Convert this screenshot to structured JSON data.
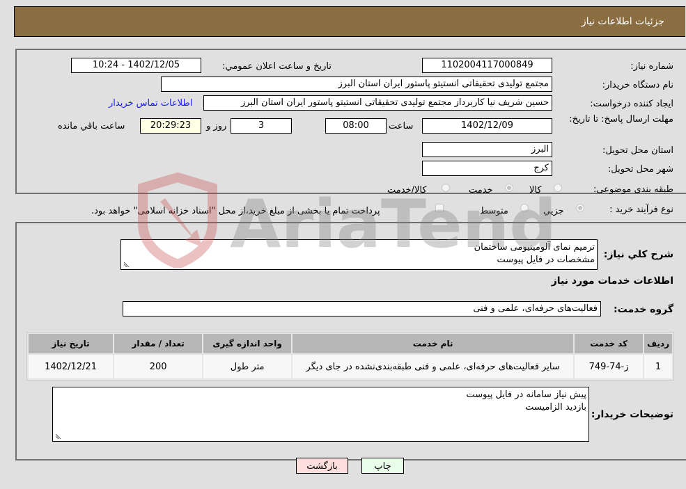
{
  "header": {
    "title": "جزئیات اطلاعات نیاز"
  },
  "fields": {
    "need_number_label": "شماره نیاز:",
    "need_number": "1102004117000849",
    "announce_label": "تاریخ و ساعت اعلان عمومي:",
    "announce_value": "1402/12/05 - 10:24",
    "buyer_org_label": "نام دستگاه خريدار:",
    "buyer_org": "مجتمع تولیدی تحقیقاتی انستیتو پاستور ایران استان البرز",
    "creator_label": "ايجاد کننده درخواست:",
    "creator": "حسین شریف نیا کاربرداز مجتمع تولیدی تحقیقاتی انستیتو پاستور ایران استان البرز",
    "contact_link": "اطلاعات تماس خريدار",
    "deadline_label": "مهلت ارسال پاسخ: تا تاریخ:",
    "deadline_date": "1402/12/09",
    "hour_label": "ساعت",
    "deadline_time": "08:00",
    "days": "3",
    "days_label": "روز و",
    "remaining_time": "20:29:23",
    "remaining_label": "ساعت باقي مانده",
    "province_label": "استان محل تحويل:",
    "province": "البرز",
    "city_label": "شهر محل تحويل:",
    "city": "کرج",
    "category_label": "طبقه بندی موضوعی:",
    "category_options": [
      {
        "label": "کالا",
        "checked": false
      },
      {
        "label": "خدمت",
        "checked": true
      },
      {
        "label": "کالا/خدمت",
        "checked": false
      }
    ],
    "process_label": "نوع فرآيند خريد :",
    "process_options": [
      {
        "label": "جزيي",
        "checked": true
      },
      {
        "label": "متوسط",
        "checked": false
      }
    ],
    "treasury_checkbox_label": "پرداخت تمام یا بخشی از مبلغ خرید،از محل \"اسناد خزانه اسلامی\" خواهد بود."
  },
  "description": {
    "label": "شرح كلي نياز:",
    "lines": [
      "ترمیم نمای آلومینیومی ساختمان",
      "مشخصات در فایل پیوست"
    ]
  },
  "services_section_title": "اطلاعات خدمات مورد نياز",
  "service_group": {
    "label": "گروه خدمت:",
    "value": "فعالیت‌های حرفه‌ای، علمی و فنی"
  },
  "table": {
    "headers": [
      "ردیف",
      "کد خدمت",
      "نام خدمت",
      "واحد اندازه گیری",
      "تعداد / مقدار",
      "تاریخ نیاز"
    ],
    "rows": [
      [
        "1",
        "ز-74-749",
        "سایر فعالیت‌های حرفه‌ای، علمی و فنی طبقه‌بندی‌نشده در جای دیگر",
        "متر طول",
        "200",
        "1402/12/21"
      ]
    ]
  },
  "buyer_notes": {
    "label": "توضيحات خريدار:",
    "lines": [
      "پیش نیاز سامانه در فایل پیوست",
      "بازدید الزامیست"
    ]
  },
  "buttons": {
    "print": "چاپ",
    "back": "بازگشت"
  },
  "watermark": {
    "text": "AriaTender.neT"
  },
  "colors": {
    "header_bg": "#8b6d42",
    "link": "#1a1aff",
    "back_btn": "#ffdede",
    "print_btn": "#eaffea"
  }
}
